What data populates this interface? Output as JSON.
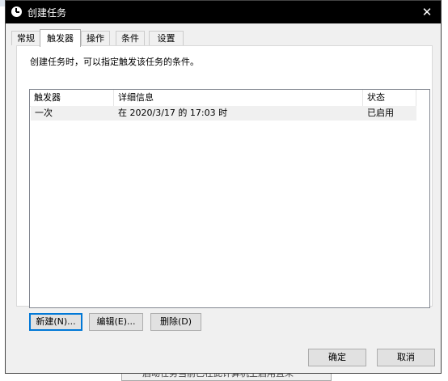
{
  "window": {
    "title": "创建任务",
    "close_glyph": "✕"
  },
  "tabs": [
    {
      "label": "常规"
    },
    {
      "label": "触发器"
    },
    {
      "label": "操作"
    },
    {
      "label": "条件"
    },
    {
      "label": "设置"
    }
  ],
  "active_tab": "触发器",
  "panel": {
    "description": "创建任务时，可以指定触发该任务的条件。",
    "columns": [
      "触发器",
      "详细信息",
      "状态"
    ],
    "rows": [
      {
        "trigger": "一次",
        "details": "在 2020/3/17 的 17:03 时",
        "status": "已启用"
      }
    ],
    "buttons": {
      "new": "新建(N)...",
      "edit": "编辑(E)...",
      "delete": "删除(D)"
    }
  },
  "footer": {
    "ok": "确定",
    "cancel": "取消"
  },
  "background": {
    "strip_text": "启动任务当前已在此计算机上启用且未"
  },
  "colors": {
    "titlebar": "#000000",
    "accent": "#0078d7",
    "dialog_bg": "#f0f0f0",
    "selected_row": "#f0f0f0"
  }
}
